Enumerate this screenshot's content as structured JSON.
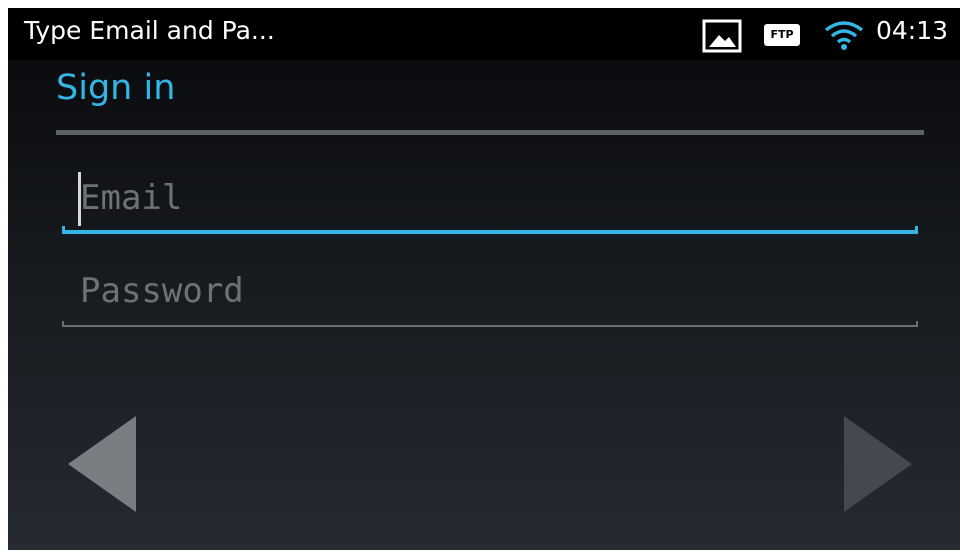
{
  "status_bar": {
    "notification_title": "Type Email and Pa...",
    "icons": [
      "gallery-icon",
      "ftp-icon",
      "wifi-icon"
    ],
    "ftp_label": "FTP",
    "time": "04:13"
  },
  "dialog": {
    "title": "Sign in",
    "email": {
      "value": "",
      "placeholder": "Email",
      "focused": true
    },
    "password": {
      "value": "",
      "placeholder": "Password"
    },
    "navigation": {
      "back_icon": "triangle-left-icon",
      "next_icon": "triangle-right-icon"
    }
  },
  "colors": {
    "accent": "#33b5e5",
    "divider": "#5e6166",
    "nav_arrow_left": "#7a7d82",
    "nav_arrow_right": "#45484e"
  }
}
